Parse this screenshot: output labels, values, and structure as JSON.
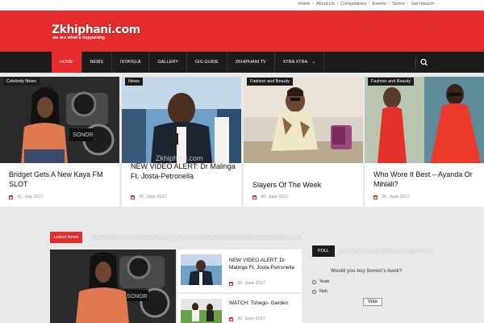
{
  "topbar": {
    "links": [
      "Home",
      "About Us",
      "Competitions",
      "Events",
      "Stores",
      "Get Intouch"
    ]
  },
  "header": {
    "logo_text": "Zkhiphani.com",
    "tagline": "we are what's happening",
    "color": "#e52b2b"
  },
  "nav": {
    "items": [
      "HOME",
      "NEWS",
      "ISTAYELA",
      "GALLERY",
      "GIG GUIDE",
      "ZKHIPHANI TV",
      "XTRA XTRA"
    ],
    "xtra_caret": "⌄",
    "active_index": 0
  },
  "featured": [
    {
      "category": "Celebrity News",
      "title": "Bridget Gets A New Kaya FM SLOT",
      "date": "01, July 2017"
    },
    {
      "category": "News",
      "title": "NEW VIDEO ALERT: Dr Malinga Ft. Josta-Petronella",
      "date": "30, June 2017"
    },
    {
      "category": "Fashion and Beauty",
      "title": "Slayers Of The Week",
      "date": "30, June 2017"
    },
    {
      "category": "Fashion and Beauty",
      "title": "Who Wore It Best – Ayanda Or Mihlali?",
      "date": "30, June 2017"
    }
  ],
  "latest": {
    "label": "Latest News",
    "items": [
      {
        "title": "NEW VIDEO ALERT: Dr Malinga Ft. Josta-Petronella",
        "date": "30, June 2017"
      },
      {
        "title": "WATCH: Tshego- Garden",
        "date": "30, June 2017"
      }
    ]
  },
  "poll": {
    "label": "POLL",
    "question": "Would you buy Somizi's book?",
    "options": [
      "Yeah",
      "Nah"
    ],
    "vote_label": "Vote"
  },
  "icons": {
    "search": "search-icon",
    "calendar": "calendar-icon"
  }
}
